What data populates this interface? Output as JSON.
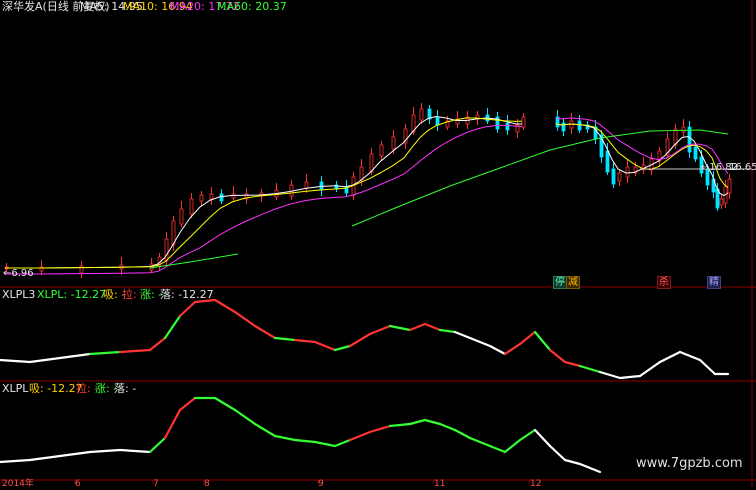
{
  "header": {
    "stock": "深华发A(日线 前复权)",
    "ma5": "MA5: 14.95",
    "ma10": "MA10: 16.94",
    "ma20": "MA20: 17.72",
    "ma60": "MA60: 20.37"
  },
  "price_labels": {
    "low": "6.96",
    "current_a": "16.82",
    "current_b": "16.65"
  },
  "signal_tags": [
    "停",
    "减",
    "杀",
    "精"
  ],
  "panel2": {
    "name": "XLPL3",
    "xlpl": "XLPL: -12.27",
    "xi": "吸: -",
    "la": "拉: -",
    "zhang": "涨: -",
    "luo": "落: -12.27"
  },
  "panel3": {
    "name": "XLPL",
    "xi": "吸: -12.27",
    "la": "拉: -",
    "zhang": "涨: -",
    "luo": "落: -"
  },
  "x_axis": {
    "year": "2014年",
    "months": [
      "6",
      "7",
      "8",
      "9",
      "11",
      "12",
      "2014年"
    ]
  },
  "watermark": "www.7gpzb.com",
  "colors": {
    "up": "#ff3333",
    "down": "#00e5ff",
    "ma5": "#ffffff",
    "ma10": "#ffff00",
    "ma20": "#ff33ff",
    "ma60": "#33ff33",
    "panel_border": "#8b0000"
  }
}
